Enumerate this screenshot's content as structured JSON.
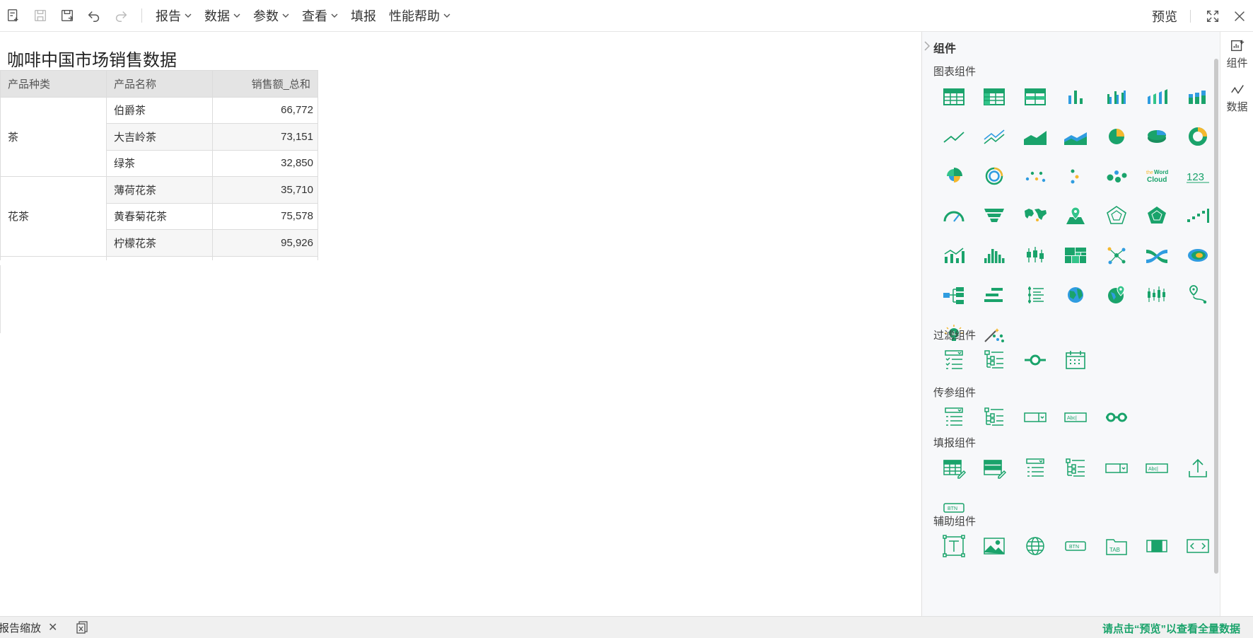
{
  "toolbar": {
    "menus": [
      "报告",
      "数据",
      "参数",
      "查看",
      "填报",
      "性能帮助"
    ],
    "preview_label": "预览"
  },
  "report": {
    "title": "咖啡中国市场销售数据",
    "columns": [
      "产品种类",
      "产品名称",
      "销售额_总和"
    ],
    "groups": [
      {
        "category": "茶",
        "rows": [
          {
            "name": "伯爵茶",
            "value": "66,772"
          },
          {
            "name": "大吉岭茶",
            "value": "73,151"
          },
          {
            "name": "绿茶",
            "value": "32,850"
          }
        ]
      },
      {
        "category": "花茶",
        "rows": [
          {
            "name": "薄荷花茶",
            "value": "35,710"
          },
          {
            "name": "黄春菊花茶",
            "value": "75,578"
          },
          {
            "name": "柠檬花茶",
            "value": "95,926"
          }
        ]
      }
    ]
  },
  "panel": {
    "title": "组件",
    "sections": {
      "chart": "图表组件",
      "filter": "过滤组件",
      "param": "传参组件",
      "fill": "填报组件",
      "aux": "辅助组件"
    }
  },
  "rail": {
    "components": "组件",
    "data": "数据"
  },
  "status": {
    "zoom_label": "报告缩放",
    "hint": "请点击“预览”以查看全量数据"
  },
  "colors": {
    "accent": "#1aa36b",
    "accent_light": "#33c48a",
    "blue": "#2f9ce0",
    "yellow": "#f5b82e"
  }
}
